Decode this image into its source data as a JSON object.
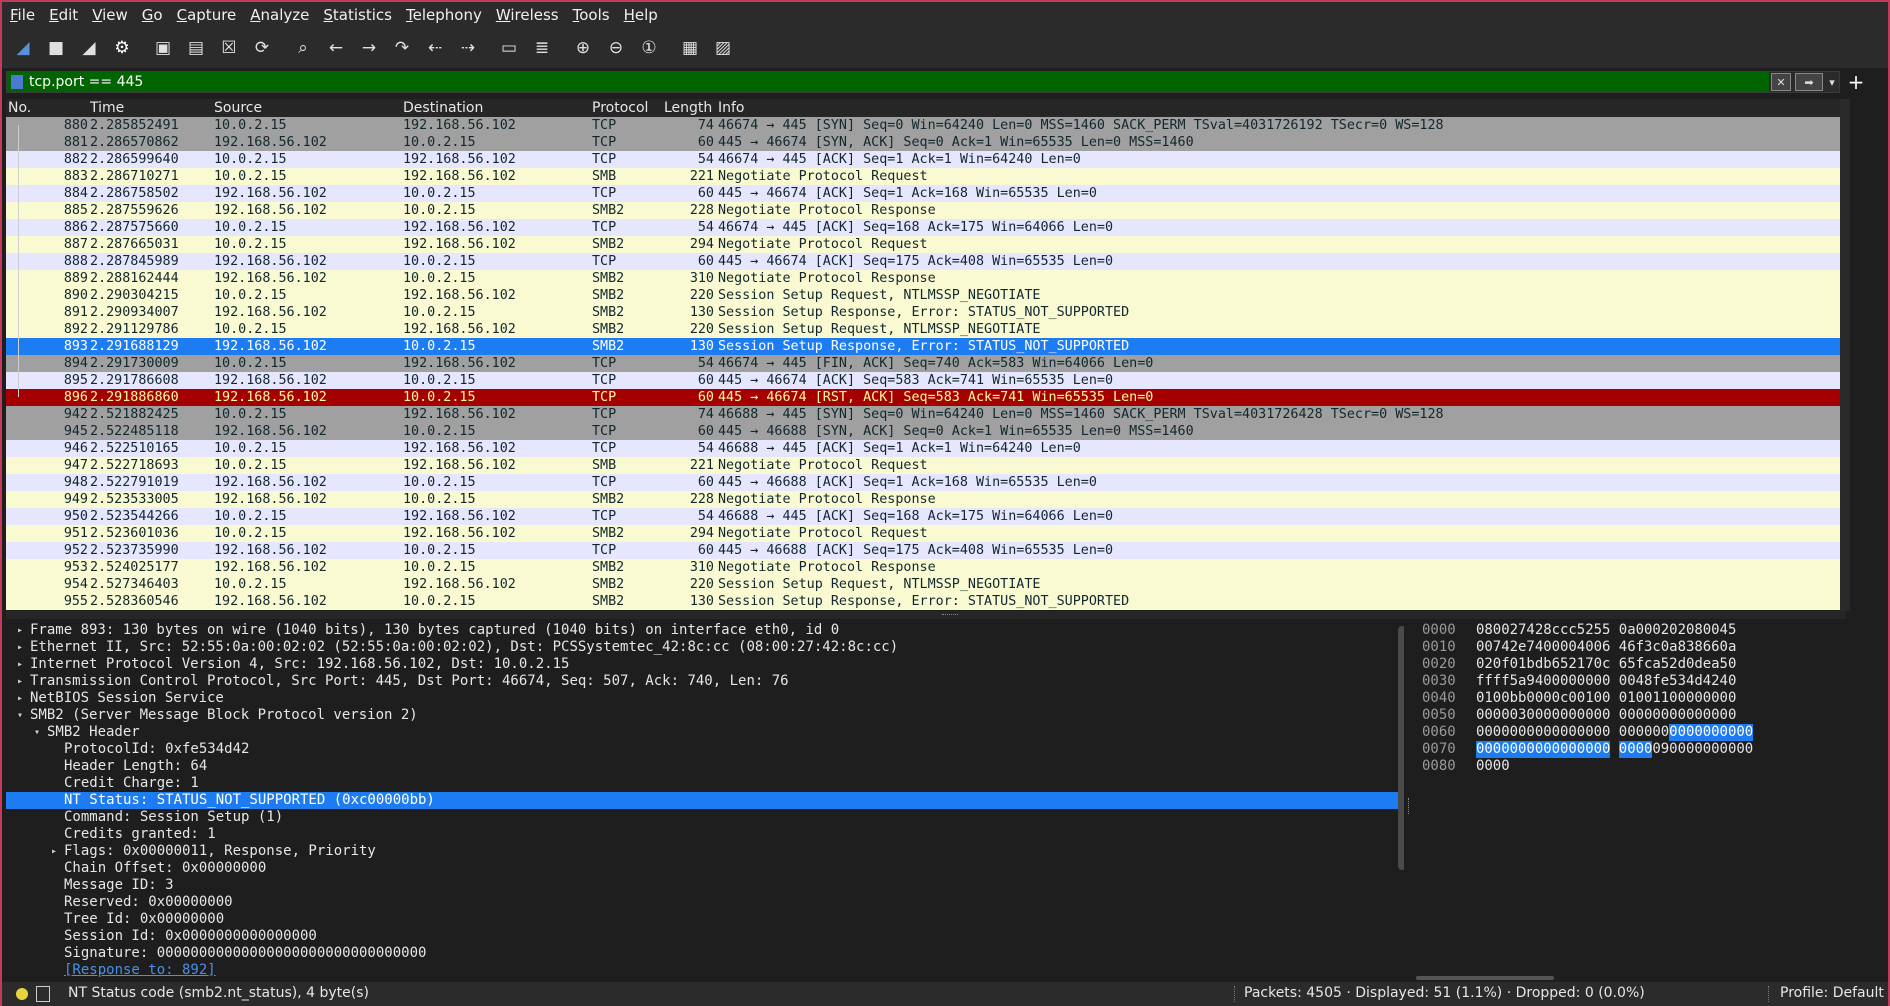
{
  "menu": [
    {
      "label": "File",
      "u": "F",
      "rest": "ile"
    },
    {
      "label": "Edit",
      "u": "E",
      "rest": "dit"
    },
    {
      "label": "View",
      "u": "V",
      "rest": "iew"
    },
    {
      "label": "Go",
      "u": "G",
      "rest": "o"
    },
    {
      "label": "Capture",
      "u": "C",
      "rest": "apture"
    },
    {
      "label": "Analyze",
      "u": "A",
      "rest": "nalyze"
    },
    {
      "label": "Statistics",
      "u": "S",
      "rest": "tatistics"
    },
    {
      "label": "Telephony",
      "u": "T",
      "rest": "elephony"
    },
    {
      "label": "Wireless",
      "u": "W",
      "rest": "ireless"
    },
    {
      "label": "Tools",
      "u": "T",
      "rest": "ools"
    },
    {
      "label": "Help",
      "u": "H",
      "rest": "elp"
    }
  ],
  "toolbar_icons": [
    {
      "name": "start-capture-icon",
      "glyph": "◢"
    },
    {
      "name": "stop-capture-icon",
      "glyph": "■"
    },
    {
      "name": "restart-capture-icon",
      "glyph": "◢"
    },
    {
      "name": "capture-options-icon",
      "glyph": "⚙"
    },
    {
      "name": "open-file-icon",
      "glyph": "▣"
    },
    {
      "name": "save-file-icon",
      "glyph": "▤"
    },
    {
      "name": "close-file-icon",
      "glyph": "☒"
    },
    {
      "name": "reload-file-icon",
      "glyph": "⟳"
    },
    {
      "name": "find-packet-icon",
      "glyph": "⌕"
    },
    {
      "name": "go-back-icon",
      "glyph": "←"
    },
    {
      "name": "go-forward-icon",
      "glyph": "→"
    },
    {
      "name": "go-to-packet-icon",
      "glyph": "↷"
    },
    {
      "name": "go-first-packet-icon",
      "glyph": "⇠"
    },
    {
      "name": "go-last-packet-icon",
      "glyph": "⇢"
    },
    {
      "name": "autoscroll-icon",
      "glyph": "▭"
    },
    {
      "name": "colorize-icon",
      "glyph": "≣"
    },
    {
      "name": "zoom-in-icon",
      "glyph": "⊕"
    },
    {
      "name": "zoom-out-icon",
      "glyph": "⊖"
    },
    {
      "name": "normal-size-icon",
      "glyph": "①"
    },
    {
      "name": "resize-columns-icon",
      "glyph": "▦"
    },
    {
      "name": "layout-icon",
      "glyph": "▨"
    }
  ],
  "filter": {
    "value": "tcp.port == 445"
  },
  "columns": {
    "no": "No.",
    "time": "Time",
    "source": "Source",
    "destination": "Destination",
    "protocol": "Protocol",
    "length": "Length",
    "info": "Info"
  },
  "colors": {
    "tcp_gray": "#a0a0a0",
    "smb_yellow": "#fdfdd2",
    "selected": "#1e7cf2",
    "rst_red": "#a40000",
    "syn_gray": "#a0a0a0",
    "plain": "#e6e6fa"
  },
  "packets": [
    {
      "no": "880",
      "time": "2.285852491",
      "src": "10.0.2.15",
      "dst": "192.168.56.102",
      "proto": "TCP",
      "len": "74",
      "info": "46674 → 445 [SYN] Seq=0 Win=64240 Len=0 MSS=1460 SACK_PERM TSval=4031726192 TSecr=0 WS=128",
      "style": "gray"
    },
    {
      "no": "881",
      "time": "2.286570862",
      "src": "192.168.56.102",
      "dst": "10.0.2.15",
      "proto": "TCP",
      "len": "60",
      "info": "445 → 46674 [SYN, ACK] Seq=0 Ack=1 Win=65535 Len=0 MSS=1460",
      "style": "gray"
    },
    {
      "no": "882",
      "time": "2.286599640",
      "src": "10.0.2.15",
      "dst": "192.168.56.102",
      "proto": "TCP",
      "len": "54",
      "info": "46674 → 445 [ACK] Seq=1 Ack=1 Win=64240 Len=0",
      "style": "lav"
    },
    {
      "no": "883",
      "time": "2.286710271",
      "src": "10.0.2.15",
      "dst": "192.168.56.102",
      "proto": "SMB",
      "len": "221",
      "info": "Negotiate Protocol Request",
      "style": "yel"
    },
    {
      "no": "884",
      "time": "2.286758502",
      "src": "192.168.56.102",
      "dst": "10.0.2.15",
      "proto": "TCP",
      "len": "60",
      "info": "445 → 46674 [ACK] Seq=1 Ack=168 Win=65535 Len=0",
      "style": "lav"
    },
    {
      "no": "885",
      "time": "2.287559626",
      "src": "192.168.56.102",
      "dst": "10.0.2.15",
      "proto": "SMB2",
      "len": "228",
      "info": "Negotiate Protocol Response",
      "style": "yel"
    },
    {
      "no": "886",
      "time": "2.287575660",
      "src": "10.0.2.15",
      "dst": "192.168.56.102",
      "proto": "TCP",
      "len": "54",
      "info": "46674 → 445 [ACK] Seq=168 Ack=175 Win=64066 Len=0",
      "style": "lav"
    },
    {
      "no": "887",
      "time": "2.287665031",
      "src": "10.0.2.15",
      "dst": "192.168.56.102",
      "proto": "SMB2",
      "len": "294",
      "info": "Negotiate Protocol Request",
      "style": "yel"
    },
    {
      "no": "888",
      "time": "2.287845989",
      "src": "192.168.56.102",
      "dst": "10.0.2.15",
      "proto": "TCP",
      "len": "60",
      "info": "445 → 46674 [ACK] Seq=175 Ack=408 Win=65535 Len=0",
      "style": "lav"
    },
    {
      "no": "889",
      "time": "2.288162444",
      "src": "192.168.56.102",
      "dst": "10.0.2.15",
      "proto": "SMB2",
      "len": "310",
      "info": "Negotiate Protocol Response",
      "style": "yel"
    },
    {
      "no": "890",
      "time": "2.290304215",
      "src": "10.0.2.15",
      "dst": "192.168.56.102",
      "proto": "SMB2",
      "len": "220",
      "info": "Session Setup Request, NTLMSSP_NEGOTIATE",
      "style": "yel"
    },
    {
      "no": "891",
      "time": "2.290934007",
      "src": "192.168.56.102",
      "dst": "10.0.2.15",
      "proto": "SMB2",
      "len": "130",
      "info": "Session Setup Response, Error: STATUS_NOT_SUPPORTED",
      "style": "yel"
    },
    {
      "no": "892",
      "time": "2.291129786",
      "src": "10.0.2.15",
      "dst": "192.168.56.102",
      "proto": "SMB2",
      "len": "220",
      "info": "Session Setup Request, NTLMSSP_NEGOTIATE",
      "style": "yel"
    },
    {
      "no": "893",
      "time": "2.291688129",
      "src": "192.168.56.102",
      "dst": "10.0.2.15",
      "proto": "SMB2",
      "len": "130",
      "info": "Session Setup Response, Error: STATUS_NOT_SUPPORTED",
      "style": "sel"
    },
    {
      "no": "894",
      "time": "2.291730009",
      "src": "10.0.2.15",
      "dst": "192.168.56.102",
      "proto": "TCP",
      "len": "54",
      "info": "46674 → 445 [FIN, ACK] Seq=740 Ack=583 Win=64066 Len=0",
      "style": "gray"
    },
    {
      "no": "895",
      "time": "2.291786608",
      "src": "192.168.56.102",
      "dst": "10.0.2.15",
      "proto": "TCP",
      "len": "60",
      "info": "445 → 46674 [ACK] Seq=583 Ack=741 Win=65535 Len=0",
      "style": "lav"
    },
    {
      "no": "896",
      "time": "2.291886860",
      "src": "192.168.56.102",
      "dst": "10.0.2.15",
      "proto": "TCP",
      "len": "60",
      "info": "445 → 46674 [RST, ACK] Seq=583 Ack=741 Win=65535 Len=0",
      "style": "red"
    },
    {
      "no": "942",
      "time": "2.521882425",
      "src": "10.0.2.15",
      "dst": "192.168.56.102",
      "proto": "TCP",
      "len": "74",
      "info": "46688 → 445 [SYN] Seq=0 Win=64240 Len=0 MSS=1460 SACK_PERM TSval=4031726428 TSecr=0 WS=128",
      "style": "gray"
    },
    {
      "no": "945",
      "time": "2.522485118",
      "src": "192.168.56.102",
      "dst": "10.0.2.15",
      "proto": "TCP",
      "len": "60",
      "info": "445 → 46688 [SYN, ACK] Seq=0 Ack=1 Win=65535 Len=0 MSS=1460",
      "style": "gray"
    },
    {
      "no": "946",
      "time": "2.522510165",
      "src": "10.0.2.15",
      "dst": "192.168.56.102",
      "proto": "TCP",
      "len": "54",
      "info": "46688 → 445 [ACK] Seq=1 Ack=1 Win=64240 Len=0",
      "style": "lav"
    },
    {
      "no": "947",
      "time": "2.522718693",
      "src": "10.0.2.15",
      "dst": "192.168.56.102",
      "proto": "SMB",
      "len": "221",
      "info": "Negotiate Protocol Request",
      "style": "yel"
    },
    {
      "no": "948",
      "time": "2.522791019",
      "src": "192.168.56.102",
      "dst": "10.0.2.15",
      "proto": "TCP",
      "len": "60",
      "info": "445 → 46688 [ACK] Seq=1 Ack=168 Win=65535 Len=0",
      "style": "lav"
    },
    {
      "no": "949",
      "time": "2.523533005",
      "src": "192.168.56.102",
      "dst": "10.0.2.15",
      "proto": "SMB2",
      "len": "228",
      "info": "Negotiate Protocol Response",
      "style": "yel"
    },
    {
      "no": "950",
      "time": "2.523544266",
      "src": "10.0.2.15",
      "dst": "192.168.56.102",
      "proto": "TCP",
      "len": "54",
      "info": "46688 → 445 [ACK] Seq=168 Ack=175 Win=64066 Len=0",
      "style": "lav"
    },
    {
      "no": "951",
      "time": "2.523601036",
      "src": "10.0.2.15",
      "dst": "192.168.56.102",
      "proto": "SMB2",
      "len": "294",
      "info": "Negotiate Protocol Request",
      "style": "yel"
    },
    {
      "no": "952",
      "time": "2.523735990",
      "src": "192.168.56.102",
      "dst": "10.0.2.15",
      "proto": "TCP",
      "len": "60",
      "info": "445 → 46688 [ACK] Seq=175 Ack=408 Win=65535 Len=0",
      "style": "lav"
    },
    {
      "no": "953",
      "time": "2.524025177",
      "src": "192.168.56.102",
      "dst": "10.0.2.15",
      "proto": "SMB2",
      "len": "310",
      "info": "Negotiate Protocol Response",
      "style": "yel"
    },
    {
      "no": "954",
      "time": "2.527346403",
      "src": "10.0.2.15",
      "dst": "192.168.56.102",
      "proto": "SMB2",
      "len": "220",
      "info": "Session Setup Request, NTLMSSP_NEGOTIATE",
      "style": "yel"
    },
    {
      "no": "955",
      "time": "2.528360546",
      "src": "192.168.56.102",
      "dst": "10.0.2.15",
      "proto": "SMB2",
      "len": "130",
      "info": "Session Setup Response, Error: STATUS_NOT_SUPPORTED",
      "style": "yel"
    }
  ],
  "details": [
    {
      "level": 0,
      "toggle": "closed",
      "text": "Frame 893: 130 bytes on wire (1040 bits), 130 bytes captured (1040 bits) on interface eth0, id 0"
    },
    {
      "level": 0,
      "toggle": "closed",
      "text": "Ethernet II, Src: 52:55:0a:00:02:02 (52:55:0a:00:02:02), Dst: PCSSystemtec_42:8c:cc (08:00:27:42:8c:cc)"
    },
    {
      "level": 0,
      "toggle": "closed",
      "text": "Internet Protocol Version 4, Src: 192.168.56.102, Dst: 10.0.2.15"
    },
    {
      "level": 0,
      "toggle": "closed",
      "text": "Transmission Control Protocol, Src Port: 445, Dst Port: 46674, Seq: 507, Ack: 740, Len: 76"
    },
    {
      "level": 0,
      "toggle": "closed",
      "text": "NetBIOS Session Service"
    },
    {
      "level": 0,
      "toggle": "open",
      "text": "SMB2 (Server Message Block Protocol version 2)"
    },
    {
      "level": 1,
      "toggle": "open",
      "text": "SMB2 Header"
    },
    {
      "level": 2,
      "toggle": "none",
      "text": "ProtocolId: 0xfe534d42"
    },
    {
      "level": 2,
      "toggle": "none",
      "text": "Header Length: 64"
    },
    {
      "level": 2,
      "toggle": "none",
      "text": "Credit Charge: 1"
    },
    {
      "level": 2,
      "toggle": "none",
      "text": "NT Status: STATUS_NOT_SUPPORTED (0xc00000bb)",
      "selected": true
    },
    {
      "level": 2,
      "toggle": "none",
      "text": "Command: Session Setup (1)"
    },
    {
      "level": 2,
      "toggle": "none",
      "text": "Credits granted: 1"
    },
    {
      "level": 2,
      "toggle": "closed",
      "text": "Flags: 0x00000011, Response, Priority"
    },
    {
      "level": 2,
      "toggle": "none",
      "text": "Chain Offset: 0x00000000"
    },
    {
      "level": 2,
      "toggle": "none",
      "text": "Message ID: 3"
    },
    {
      "level": 2,
      "toggle": "none",
      "text": "Reserved: 0x00000000"
    },
    {
      "level": 2,
      "toggle": "none",
      "text": "Tree Id: 0x00000000"
    },
    {
      "level": 2,
      "toggle": "none",
      "text": "Session Id: 0x0000000000000000"
    },
    {
      "level": 2,
      "toggle": "none",
      "text": "Signature: 00000000000000000000000000000000"
    },
    {
      "level": 2,
      "toggle": "none",
      "text": "[Response to: 892]",
      "link": true
    }
  ],
  "hex": [
    {
      "off": "0000",
      "bytes": [
        "08",
        "00",
        "27",
        "42",
        "8c",
        "cc",
        "52",
        "55",
        "0a",
        "00",
        "02",
        "02",
        "08",
        "00",
        "45"
      ],
      "sel": []
    },
    {
      "off": "0010",
      "bytes": [
        "00",
        "74",
        "2e",
        "74",
        "00",
        "00",
        "40",
        "06",
        "46",
        "f3",
        "c0",
        "a8",
        "38",
        "66",
        "0a"
      ],
      "sel": []
    },
    {
      "off": "0020",
      "bytes": [
        "02",
        "0f",
        "01",
        "bd",
        "b6",
        "52",
        "17",
        "0c",
        "65",
        "fc",
        "a5",
        "2d",
        "0d",
        "ea",
        "50"
      ],
      "sel": []
    },
    {
      "off": "0030",
      "bytes": [
        "ff",
        "ff",
        "5a",
        "94",
        "00",
        "00",
        "00",
        "00",
        "00",
        "48",
        "fe",
        "53",
        "4d",
        "42",
        "40"
      ],
      "sel": []
    },
    {
      "off": "0040",
      "bytes": [
        "01",
        "00",
        "bb",
        "00",
        "00",
        "c0",
        "01",
        "00",
        "01",
        "00",
        "11",
        "00",
        "00",
        "00",
        "00"
      ],
      "sel": []
    },
    {
      "off": "0050",
      "bytes": [
        "00",
        "00",
        "03",
        "00",
        "00",
        "00",
        "00",
        "00",
        "00",
        "00",
        "00",
        "00",
        "00",
        "00",
        "00"
      ],
      "sel": []
    },
    {
      "off": "0060",
      "bytes": [
        "00",
        "00",
        "00",
        "00",
        "00",
        "00",
        "00",
        "00",
        "00",
        "00",
        "00",
        "00",
        "00",
        "00",
        "00",
        "00"
      ],
      "sel": [
        11,
        12,
        13,
        14,
        15
      ]
    },
    {
      "off": "0070",
      "bytes": [
        "00",
        "00",
        "00",
        "00",
        "00",
        "00",
        "00",
        "00",
        "00",
        "00",
        "09",
        "00",
        "00",
        "00",
        "00",
        "00"
      ],
      "sel": [
        0,
        1,
        2,
        3,
        4,
        5,
        6,
        7,
        8,
        9
      ]
    },
    {
      "off": "0080",
      "bytes": [
        "00",
        "00"
      ],
      "sel": []
    }
  ],
  "status": {
    "field": "NT Status code (smb2.nt_status), 4 byte(s)",
    "packets": "Packets: 4505 · Displayed: 51 (1.1%) · Dropped: 0 (0.0%)",
    "profile": "Profile: Default"
  }
}
